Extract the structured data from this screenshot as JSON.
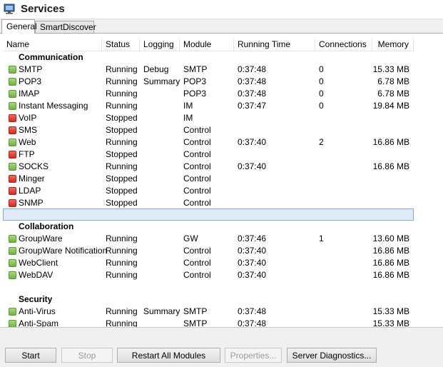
{
  "window": {
    "title": "Services"
  },
  "tabs": [
    {
      "label": "General"
    },
    {
      "label": "SmartDiscover"
    }
  ],
  "columns": {
    "name": "Name",
    "status": "Status",
    "logging": "Logging",
    "module": "Module",
    "running_time": "Running Time",
    "connections": "Connections",
    "memory": "Memory"
  },
  "groups": {
    "communication": "Communication",
    "collaboration": "Collaboration",
    "security": "Security"
  },
  "services": [
    {
      "name": "SMTP",
      "status": "Running",
      "logging": "Debug",
      "module": "SMTP",
      "time": "0:37:48",
      "conn": "0",
      "mem": "15.33 MB"
    },
    {
      "name": "POP3",
      "status": "Running",
      "logging": "Summary",
      "module": "POP3",
      "time": "0:37:48",
      "conn": "0",
      "mem": "6.78 MB"
    },
    {
      "name": "IMAP",
      "status": "Running",
      "logging": "",
      "module": "POP3",
      "time": "0:37:48",
      "conn": "0",
      "mem": "6.78 MB"
    },
    {
      "name": "Instant Messaging",
      "status": "Running",
      "logging": "",
      "module": "IM",
      "time": "0:37:47",
      "conn": "0",
      "mem": "19.84 MB"
    },
    {
      "name": "VoIP",
      "status": "Stopped",
      "logging": "",
      "module": "IM",
      "time": "",
      "conn": "",
      "mem": ""
    },
    {
      "name": "SMS",
      "status": "Stopped",
      "logging": "",
      "module": "Control",
      "time": "",
      "conn": "",
      "mem": ""
    },
    {
      "name": "Web",
      "status": "Running",
      "logging": "",
      "module": "Control",
      "time": "0:37:40",
      "conn": "2",
      "mem": "16.86 MB"
    },
    {
      "name": "FTP",
      "status": "Stopped",
      "logging": "",
      "module": "Control",
      "time": "",
      "conn": "",
      "mem": ""
    },
    {
      "name": "SOCKS",
      "status": "Running",
      "logging": "",
      "module": "Control",
      "time": "0:37:40",
      "conn": "",
      "mem": "16.86 MB"
    },
    {
      "name": "Minger",
      "status": "Stopped",
      "logging": "",
      "module": "Control",
      "time": "",
      "conn": "",
      "mem": ""
    },
    {
      "name": "LDAP",
      "status": "Stopped",
      "logging": "",
      "module": "Control",
      "time": "",
      "conn": "",
      "mem": ""
    },
    {
      "name": "SNMP",
      "status": "Stopped",
      "logging": "",
      "module": "Control",
      "time": "",
      "conn": "",
      "mem": ""
    },
    {
      "name": "GroupWare",
      "status": "Running",
      "logging": "",
      "module": "GW",
      "time": "0:37:46",
      "conn": "1",
      "mem": "13.60 MB"
    },
    {
      "name": "GroupWare Notification",
      "status": "Running",
      "logging": "",
      "module": "Control",
      "time": "0:37:40",
      "conn": "",
      "mem": "16.86 MB"
    },
    {
      "name": "WebClient",
      "status": "Running",
      "logging": "",
      "module": "Control",
      "time": "0:37:40",
      "conn": "",
      "mem": "16.86 MB"
    },
    {
      "name": "WebDAV",
      "status": "Running",
      "logging": "",
      "module": "Control",
      "time": "0:37:40",
      "conn": "",
      "mem": "16.86 MB"
    },
    {
      "name": "Anti-Virus",
      "status": "Running",
      "logging": "Summary",
      "module": "SMTP",
      "time": "0:37:48",
      "conn": "",
      "mem": "15.33 MB"
    },
    {
      "name": "Anti-Spam",
      "status": "Running",
      "logging": "",
      "module": "SMTP",
      "time": "0:37:48",
      "conn": "",
      "mem": "15.33 MB"
    }
  ],
  "buttons": {
    "start": "Start",
    "stop": "Stop",
    "restart_all": "Restart All Modules",
    "properties": "Properties...",
    "diagnostics": "Server Diagnostics..."
  },
  "colors": {
    "running": "#6fb33f",
    "stopped": "#d42a1f",
    "selection": "#dfe9f7"
  },
  "icons": {
    "app": "services-monitor-icon",
    "running": "green-status-icon",
    "stopped": "red-status-icon"
  }
}
